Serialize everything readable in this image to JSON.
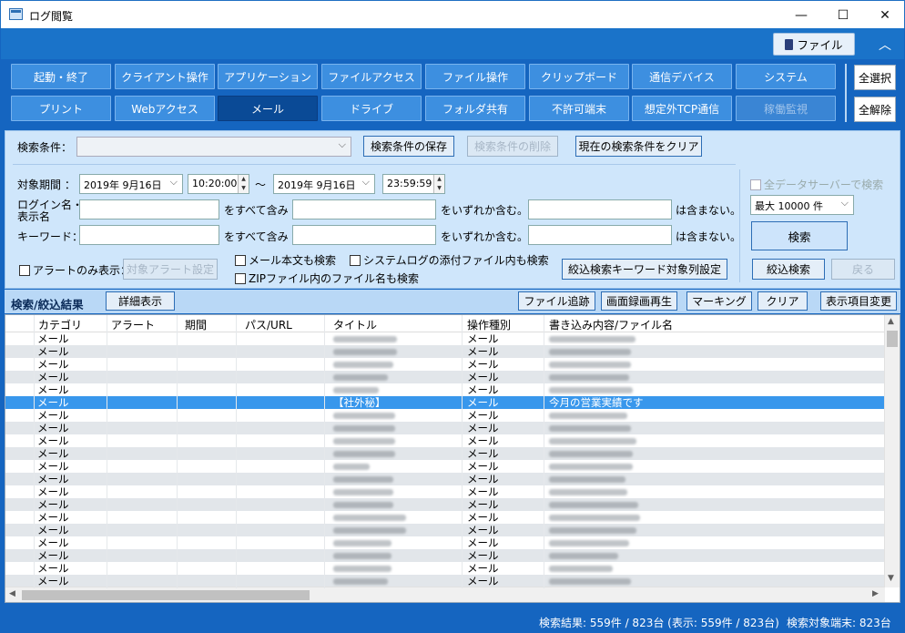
{
  "window": {
    "title": "ログ閲覧"
  },
  "topbar": {
    "file_label": "ファイル"
  },
  "categories_row1": [
    "起動・終了",
    "クライアント操作",
    "アプリケーション",
    "ファイルアクセス",
    "ファイル操作",
    "クリップボード",
    "通信デバイス",
    "システム"
  ],
  "categories_row2": [
    "プリント",
    "Webアクセス",
    "メール",
    "ドライブ",
    "フォルダ共有",
    "不許可端末",
    "想定外TCP通信",
    "稼働監視"
  ],
  "side_buttons": {
    "select_all": "全選択",
    "clear_all": "全解除"
  },
  "search": {
    "condition_label": "検索条件：",
    "save_btn": "検索条件の保存",
    "delete_btn": "検索条件の削除",
    "clear_btn": "現在の検索条件をクリア",
    "period_label": "対象期間 ：",
    "date_from": "2019年 9月16日",
    "time_from": "10:20:00",
    "tilde": "～",
    "date_to": "2019年 9月16日",
    "time_to": "23:59:59",
    "login_label_1": "ログイン名・",
    "login_label_2": "表示名",
    "keyword_label": "キーワード：",
    "all_contain": "をすべて含み",
    "any_contain": "をいずれか含む。",
    "not_contain": "は含まない。",
    "all_servers": "全データサーバーで検索",
    "max_rows": "最大 10000 件",
    "search_btn": "検索",
    "alert_only": "アラートのみ表示：",
    "alert_setting": "対象アラート設定",
    "mail_body": "メール本文も検索",
    "syslog_attach": "システムログの添付ファイル内も検索",
    "zip_names": "ZIPファイル内のファイル名も検索",
    "narrow_setting": "絞込検索キーワード対象列設定",
    "narrow_btn": "絞込検索",
    "back_btn": "戻る"
  },
  "results": {
    "title": "検索/絞込結果",
    "detail_btn": "詳細表示",
    "trace_btn": "ファイル追跡",
    "replay_btn": "画面録画再生",
    "marking_btn": "マーキング",
    "clear_btn": "クリア",
    "columns_btn": "表示項目変更",
    "headers": [
      "カテゴリ",
      "アラート",
      "期間",
      "パス/URL",
      "タイトル",
      "操作種別",
      "書き込み内容/ファイル名"
    ],
    "rows": [
      {
        "category": "メール",
        "op": "メール"
      },
      {
        "category": "メール",
        "op": "メール"
      },
      {
        "category": "メール",
        "op": "メール"
      },
      {
        "category": "メール",
        "op": "メール"
      },
      {
        "category": "メール",
        "op": "メール"
      },
      {
        "category": "メール",
        "op": "メール",
        "title": "【社外秘】",
        "content": "今月の営業実績です",
        "selected": true
      },
      {
        "category": "メール",
        "op": "メール"
      },
      {
        "category": "メール",
        "op": "メール"
      },
      {
        "category": "メール",
        "op": "メール"
      },
      {
        "category": "メール",
        "op": "メール"
      },
      {
        "category": "メール",
        "op": "メール"
      },
      {
        "category": "メール",
        "op": "メール"
      },
      {
        "category": "メール",
        "op": "メール"
      },
      {
        "category": "メール",
        "op": "メール"
      },
      {
        "category": "メール",
        "op": "メール"
      },
      {
        "category": "メール",
        "op": "メール"
      },
      {
        "category": "メール",
        "op": "メール"
      },
      {
        "category": "メール",
        "op": "メール"
      },
      {
        "category": "メール",
        "op": "メール"
      },
      {
        "category": "メール",
        "op": "メール"
      }
    ]
  },
  "status": {
    "result_text": "検索結果: 559件 / 823台 (表示: 559件 / 823台)",
    "target_text": "検索対象端末: 823台"
  }
}
